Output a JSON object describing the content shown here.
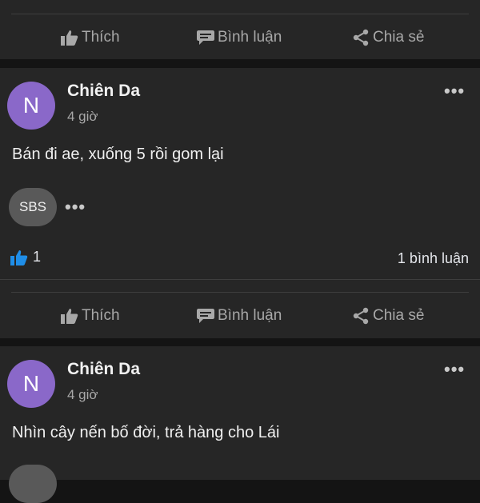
{
  "action_bar": {
    "like_label": "Thích",
    "comment_label": "Bình luận",
    "share_label": "Chia sẻ"
  },
  "posts": [
    {
      "avatar_letter": "N",
      "author": "Chiên Da",
      "time": "4 giờ",
      "text": "Bán đi ae, xuống 5 rồi gom lại",
      "commenter_avatar": "SBS",
      "like_count": "1",
      "comment_count": "1 bình luận"
    },
    {
      "avatar_letter": "N",
      "author": "Chiên Da",
      "time": "4 giờ",
      "text": "Nhìn cây nến bố đời, trả hàng cho Lái"
    }
  ],
  "icons": {
    "like": "thumbs-up-icon",
    "comment": "comment-icon",
    "share": "share-icon",
    "more": "more-dots-icon"
  },
  "colors": {
    "background": "#141414",
    "card": "#262626",
    "avatar": "#8a68c9",
    "like_blue": "#1f8ee8",
    "muted_text": "#a8a8a8"
  }
}
